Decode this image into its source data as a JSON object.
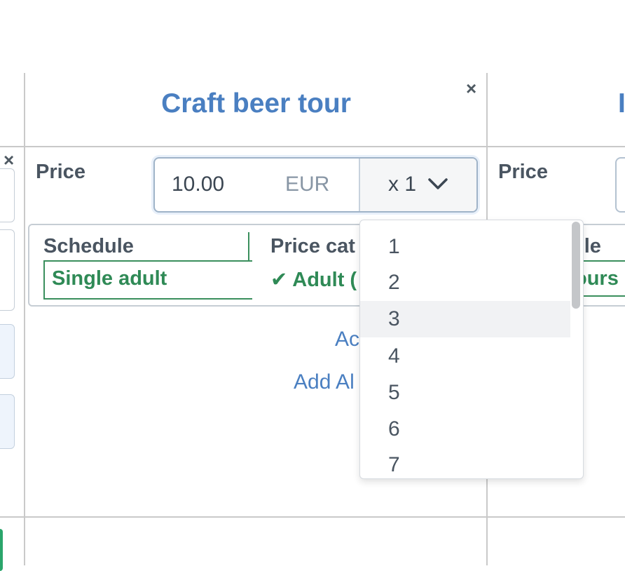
{
  "columns": {
    "main": {
      "title": "Craft beer tour",
      "close_label": "×",
      "price": {
        "label": "Price",
        "value": "10.00",
        "currency": "EUR",
        "quantity_display": "x 1"
      },
      "schedule_card": {
        "schedule_label": "Schedule",
        "schedule_value": "Single adult",
        "price_category_label": "Price cat",
        "price_category_value": "✔ Adult ("
      },
      "links": {
        "add_one": "Ac",
        "add_all": "Add Al"
      }
    },
    "left": {
      "close_label": "×"
    },
    "right": {
      "title_partial": "I",
      "price_label": "Price",
      "schedule_label_partial": "ule",
      "schedule_value_partial": "ours"
    }
  },
  "quantity_dropdown": {
    "options": [
      "1",
      "2",
      "3",
      "4",
      "5",
      "6",
      "7"
    ],
    "highlighted": "3"
  }
}
